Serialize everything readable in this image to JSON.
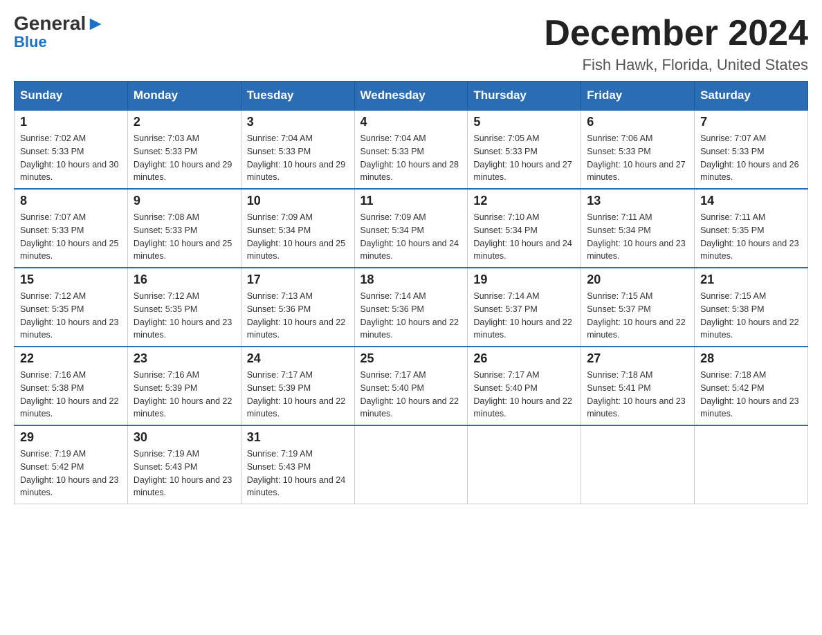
{
  "logo": {
    "line1_black": "General",
    "line1_blue": "Blue",
    "line2": "Blue"
  },
  "header": {
    "title": "December 2024",
    "subtitle": "Fish Hawk, Florida, United States"
  },
  "days_of_week": [
    "Sunday",
    "Monday",
    "Tuesday",
    "Wednesday",
    "Thursday",
    "Friday",
    "Saturday"
  ],
  "weeks": [
    [
      {
        "day": "1",
        "sunrise": "7:02 AM",
        "sunset": "5:33 PM",
        "daylight": "10 hours and 30 minutes."
      },
      {
        "day": "2",
        "sunrise": "7:03 AM",
        "sunset": "5:33 PM",
        "daylight": "10 hours and 29 minutes."
      },
      {
        "day": "3",
        "sunrise": "7:04 AM",
        "sunset": "5:33 PM",
        "daylight": "10 hours and 29 minutes."
      },
      {
        "day": "4",
        "sunrise": "7:04 AM",
        "sunset": "5:33 PM",
        "daylight": "10 hours and 28 minutes."
      },
      {
        "day": "5",
        "sunrise": "7:05 AM",
        "sunset": "5:33 PM",
        "daylight": "10 hours and 27 minutes."
      },
      {
        "day": "6",
        "sunrise": "7:06 AM",
        "sunset": "5:33 PM",
        "daylight": "10 hours and 27 minutes."
      },
      {
        "day": "7",
        "sunrise": "7:07 AM",
        "sunset": "5:33 PM",
        "daylight": "10 hours and 26 minutes."
      }
    ],
    [
      {
        "day": "8",
        "sunrise": "7:07 AM",
        "sunset": "5:33 PM",
        "daylight": "10 hours and 25 minutes."
      },
      {
        "day": "9",
        "sunrise": "7:08 AM",
        "sunset": "5:33 PM",
        "daylight": "10 hours and 25 minutes."
      },
      {
        "day": "10",
        "sunrise": "7:09 AM",
        "sunset": "5:34 PM",
        "daylight": "10 hours and 25 minutes."
      },
      {
        "day": "11",
        "sunrise": "7:09 AM",
        "sunset": "5:34 PM",
        "daylight": "10 hours and 24 minutes."
      },
      {
        "day": "12",
        "sunrise": "7:10 AM",
        "sunset": "5:34 PM",
        "daylight": "10 hours and 24 minutes."
      },
      {
        "day": "13",
        "sunrise": "7:11 AM",
        "sunset": "5:34 PM",
        "daylight": "10 hours and 23 minutes."
      },
      {
        "day": "14",
        "sunrise": "7:11 AM",
        "sunset": "5:35 PM",
        "daylight": "10 hours and 23 minutes."
      }
    ],
    [
      {
        "day": "15",
        "sunrise": "7:12 AM",
        "sunset": "5:35 PM",
        "daylight": "10 hours and 23 minutes."
      },
      {
        "day": "16",
        "sunrise": "7:12 AM",
        "sunset": "5:35 PM",
        "daylight": "10 hours and 23 minutes."
      },
      {
        "day": "17",
        "sunrise": "7:13 AM",
        "sunset": "5:36 PM",
        "daylight": "10 hours and 22 minutes."
      },
      {
        "day": "18",
        "sunrise": "7:14 AM",
        "sunset": "5:36 PM",
        "daylight": "10 hours and 22 minutes."
      },
      {
        "day": "19",
        "sunrise": "7:14 AM",
        "sunset": "5:37 PM",
        "daylight": "10 hours and 22 minutes."
      },
      {
        "day": "20",
        "sunrise": "7:15 AM",
        "sunset": "5:37 PM",
        "daylight": "10 hours and 22 minutes."
      },
      {
        "day": "21",
        "sunrise": "7:15 AM",
        "sunset": "5:38 PM",
        "daylight": "10 hours and 22 minutes."
      }
    ],
    [
      {
        "day": "22",
        "sunrise": "7:16 AM",
        "sunset": "5:38 PM",
        "daylight": "10 hours and 22 minutes."
      },
      {
        "day": "23",
        "sunrise": "7:16 AM",
        "sunset": "5:39 PM",
        "daylight": "10 hours and 22 minutes."
      },
      {
        "day": "24",
        "sunrise": "7:17 AM",
        "sunset": "5:39 PM",
        "daylight": "10 hours and 22 minutes."
      },
      {
        "day": "25",
        "sunrise": "7:17 AM",
        "sunset": "5:40 PM",
        "daylight": "10 hours and 22 minutes."
      },
      {
        "day": "26",
        "sunrise": "7:17 AM",
        "sunset": "5:40 PM",
        "daylight": "10 hours and 22 minutes."
      },
      {
        "day": "27",
        "sunrise": "7:18 AM",
        "sunset": "5:41 PM",
        "daylight": "10 hours and 23 minutes."
      },
      {
        "day": "28",
        "sunrise": "7:18 AM",
        "sunset": "5:42 PM",
        "daylight": "10 hours and 23 minutes."
      }
    ],
    [
      {
        "day": "29",
        "sunrise": "7:19 AM",
        "sunset": "5:42 PM",
        "daylight": "10 hours and 23 minutes."
      },
      {
        "day": "30",
        "sunrise": "7:19 AM",
        "sunset": "5:43 PM",
        "daylight": "10 hours and 23 minutes."
      },
      {
        "day": "31",
        "sunrise": "7:19 AM",
        "sunset": "5:43 PM",
        "daylight": "10 hours and 24 minutes."
      },
      null,
      null,
      null,
      null
    ]
  ]
}
